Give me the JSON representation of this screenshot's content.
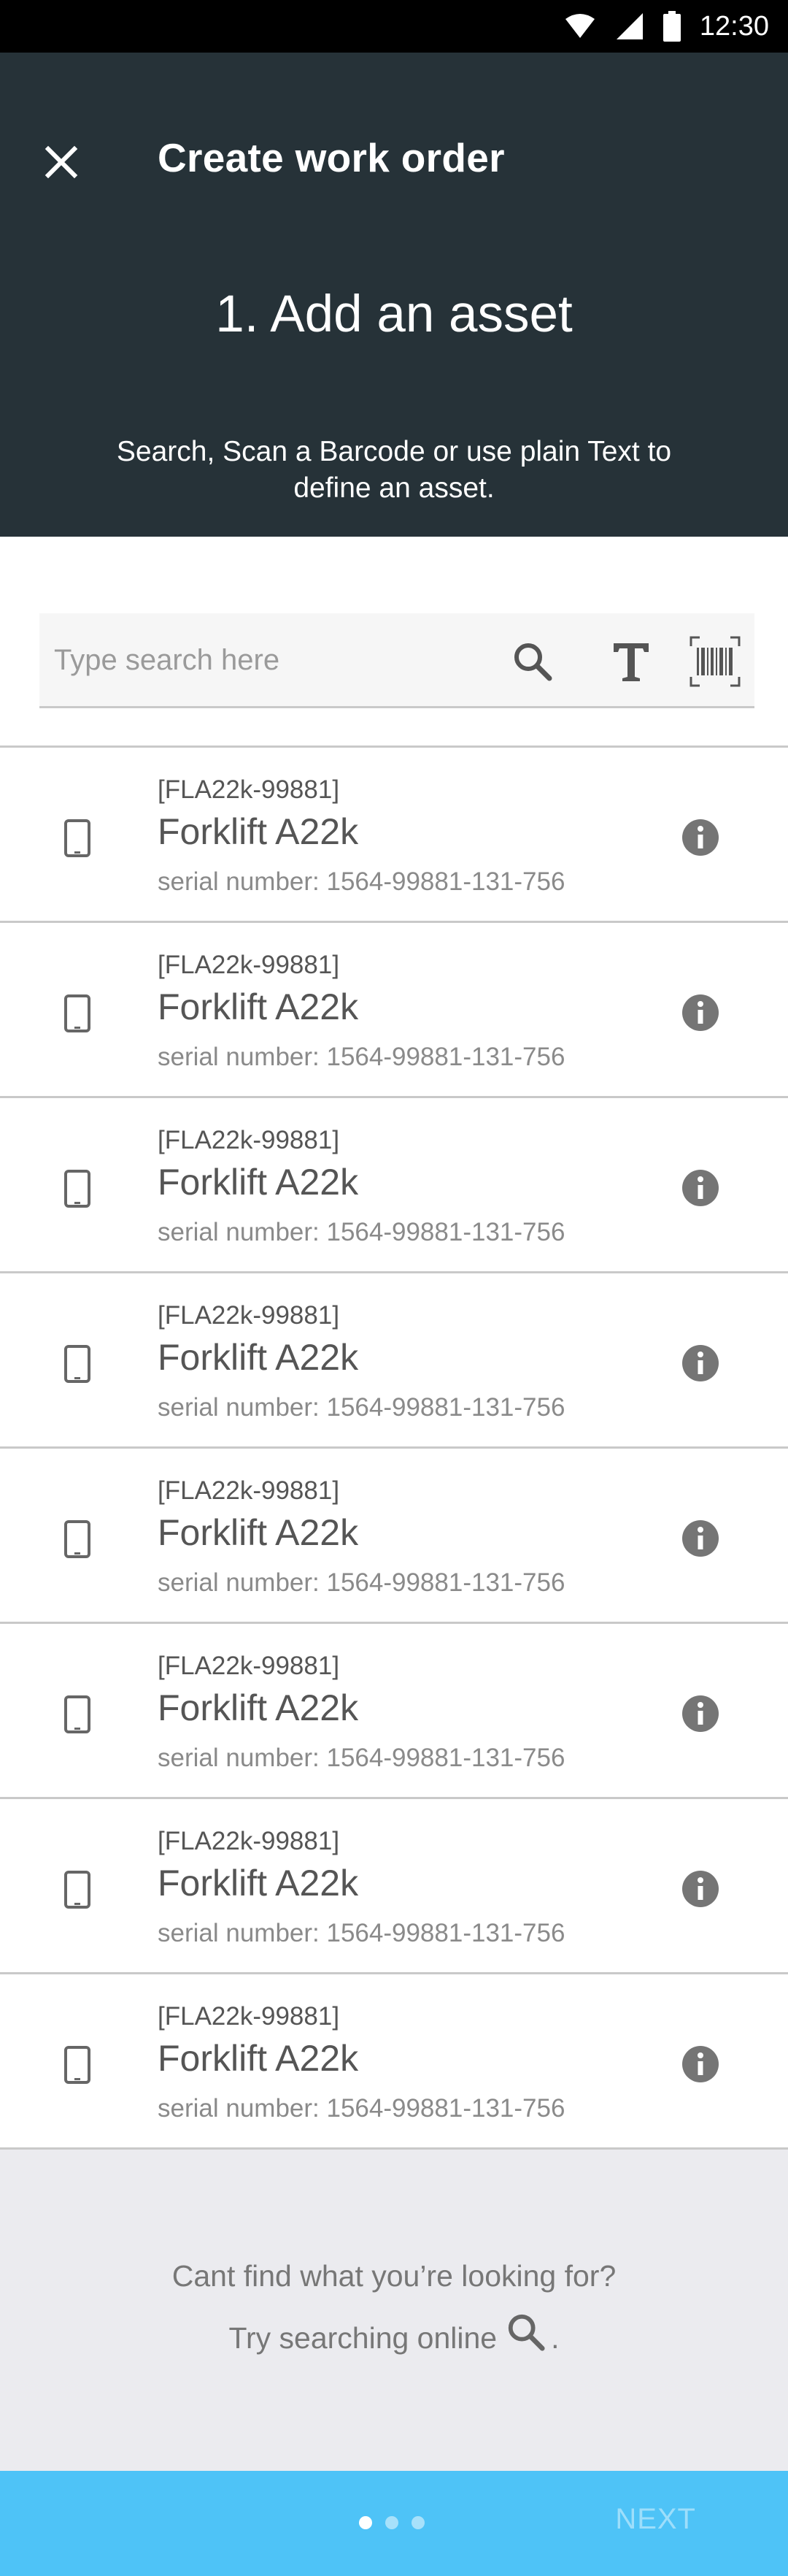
{
  "status_bar": {
    "time": "12:30"
  },
  "header": {
    "title": "Create work order",
    "step_title": "1. Add an asset",
    "instructions": "Search, Scan a Barcode or use plain Text to define an asset."
  },
  "search": {
    "placeholder": "Type search here",
    "value": ""
  },
  "assets": [
    {
      "code": "[FLA22k-99881]",
      "name": "Forklift A22k",
      "serial": "serial number: 1564-99881-131-756"
    },
    {
      "code": "[FLA22k-99881]",
      "name": "Forklift A22k",
      "serial": "serial number: 1564-99881-131-756"
    },
    {
      "code": "[FLA22k-99881]",
      "name": "Forklift A22k",
      "serial": "serial number: 1564-99881-131-756"
    },
    {
      "code": "[FLA22k-99881]",
      "name": "Forklift A22k",
      "serial": "serial number: 1564-99881-131-756"
    },
    {
      "code": "[FLA22k-99881]",
      "name": "Forklift A22k",
      "serial": "serial number: 1564-99881-131-756"
    },
    {
      "code": "[FLA22k-99881]",
      "name": "Forklift A22k",
      "serial": "serial number: 1564-99881-131-756"
    },
    {
      "code": "[FLA22k-99881]",
      "name": "Forklift A22k",
      "serial": "serial number: 1564-99881-131-756"
    },
    {
      "code": "[FLA22k-99881]",
      "name": "Forklift A22k",
      "serial": "serial number: 1564-99881-131-756"
    }
  ],
  "help": {
    "line1": "Cant find what you’re looking for?",
    "line2": "Try searching online",
    "line2_end": "."
  },
  "footer": {
    "next_label": "NEXT",
    "page_dots": 3,
    "active_dot": 1
  },
  "colors": {
    "header_bg": "#263238",
    "accent": "#4ec3f7",
    "help_bg": "#ebebef"
  },
  "icons": [
    "wifi-icon",
    "signal-icon",
    "battery-icon",
    "close-icon",
    "search-icon",
    "text-icon",
    "barcode-icon",
    "device-icon",
    "info-icon"
  ]
}
